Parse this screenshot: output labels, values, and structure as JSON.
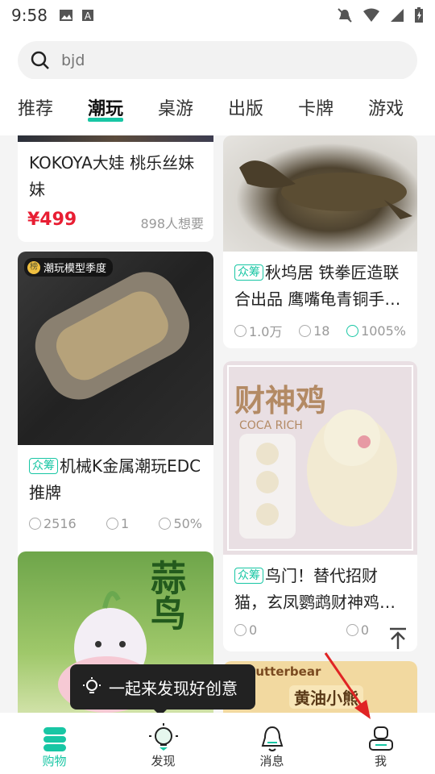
{
  "status": {
    "time": "9:58"
  },
  "search": {
    "placeholder": "bjd"
  },
  "tabs": [
    "推荐",
    "潮玩",
    "桌游",
    "出版",
    "卡牌",
    "游戏"
  ],
  "active_tab": "潮玩",
  "cards": {
    "kokoya": {
      "title": "KOKOYA大娃 桃乐丝妹妹",
      "price": "¥499",
      "want": "898人想要"
    },
    "turtle": {
      "tag": "众筹",
      "title": "秋坞居 铁拳匠造联合出品 鹰嘴龟青铜手…",
      "backers_amount": "1.0万",
      "supporters": "18",
      "progress": "1005%"
    },
    "edc": {
      "badge": "潮玩模型季度",
      "tag": "众筹",
      "title": "机械K金属潮玩EDC推牌",
      "backers_amount": "2516",
      "supporters": "1",
      "progress": "50%"
    },
    "parrot": {
      "tag": "众筹",
      "title": "鸟门！替代招财猫，玄凤鹦鹉财神鸡…",
      "backers_amount": "0",
      "supporters": "0",
      "image_text": "财神鸡",
      "image_subtext": "COCA RICH"
    },
    "garlic": {
      "image_text": "蒜鸟"
    },
    "butterbear": {
      "image_text": "黄油小熊",
      "image_brand": "x Butterbear"
    }
  },
  "toast": {
    "text": "一起来发现好创意"
  },
  "bottom_nav": [
    {
      "label": "购物",
      "icon": "shop-icon",
      "active": true
    },
    {
      "label": "发现",
      "icon": "bulb-icon",
      "active": false
    },
    {
      "label": "消息",
      "icon": "bell-icon",
      "active": false
    },
    {
      "label": "我",
      "icon": "profile-icon",
      "active": false
    }
  ],
  "colors": {
    "accent": "#18c6a4",
    "price": "#e81e33"
  }
}
